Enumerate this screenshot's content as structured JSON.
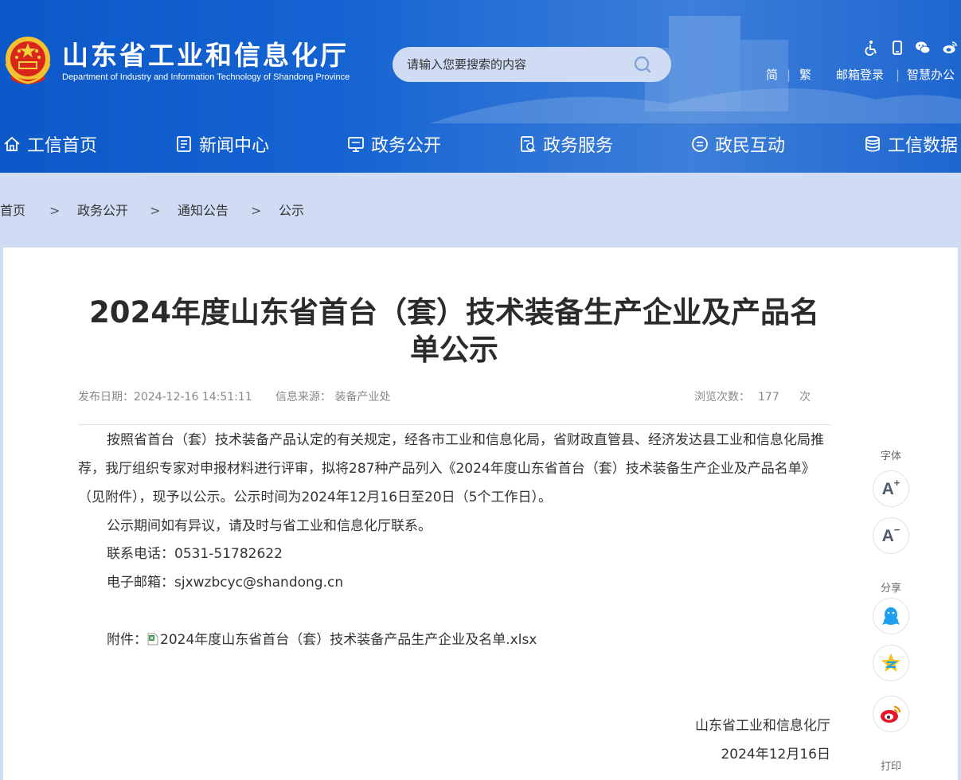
{
  "header": {
    "site_title": "山东省工业和信息化厅",
    "site_subtitle": "Department of Industry and Information Technology of Shandong Province",
    "search_placeholder": "请输入您要搜索的内容",
    "tool_icons": [
      "accessibility-icon",
      "mobile-icon",
      "wechat-icon",
      "weibo-icon"
    ],
    "top_links": {
      "simplified": "简",
      "traditional": "繁",
      "mail_login": "邮箱登录",
      "smart_office": "智慧办公",
      "separator": "|"
    }
  },
  "nav": {
    "items": [
      {
        "label": "工信首页",
        "icon": "home-icon"
      },
      {
        "label": "新闻中心",
        "icon": "news-icon"
      },
      {
        "label": "政务公开",
        "icon": "monitor-icon"
      },
      {
        "label": "政务服务",
        "icon": "service-icon"
      },
      {
        "label": "政民互动",
        "icon": "chat-icon"
      },
      {
        "label": "工信数据",
        "icon": "database-icon"
      }
    ]
  },
  "breadcrumb": {
    "items": [
      "首页",
      "政务公开",
      "通知公告",
      "公示"
    ],
    "separator": ">"
  },
  "article": {
    "title": "2024年度山东省首台（套）技术装备生产企业及产品名单公示",
    "publish_date": "发布日期：2024-12-16 14:51:11",
    "source": "信息来源：  装备产业处",
    "views_label": "浏览次数：",
    "views_count": "177",
    "views_unit": "次",
    "paragraph1": "按照省首台（套）技术装备产品认定的有关规定，经各市工业和信息化局，省财政直管县、经济发达县工业和信息化局推荐，我厅组织专家对申报材料进行评审，拟将287种产品列入《2024年度山东省首台（套）技术装备生产企业及产品名单》（见附件），现予以公示。公示时间为2024年12月16日至20日（5个工作日）。",
    "paragraph2": "公示期间如有异议，请及时与省工业和信息化厅联系。",
    "phone": "联系电话：0531-51782622",
    "email": "电子邮箱：sjxwzbcyc@shandong.cn",
    "attachment_label": "附件：",
    "attachment_name": "2024年度山东省首台（套）技术装备产品生产企业及名单.xlsx",
    "signature_org": "山东省工业和信息化厅",
    "signature_date": "2024年12月16日"
  },
  "side_tools": {
    "font_label": "字体",
    "font_increase": "A",
    "font_decrease": "A",
    "share_label": "分享",
    "print_label": "打印"
  },
  "colors": {
    "header_blue": "#1563d2",
    "page_bg": "#cfdcf3",
    "search_bg": "#cfdcf4",
    "text": "#333333"
  }
}
